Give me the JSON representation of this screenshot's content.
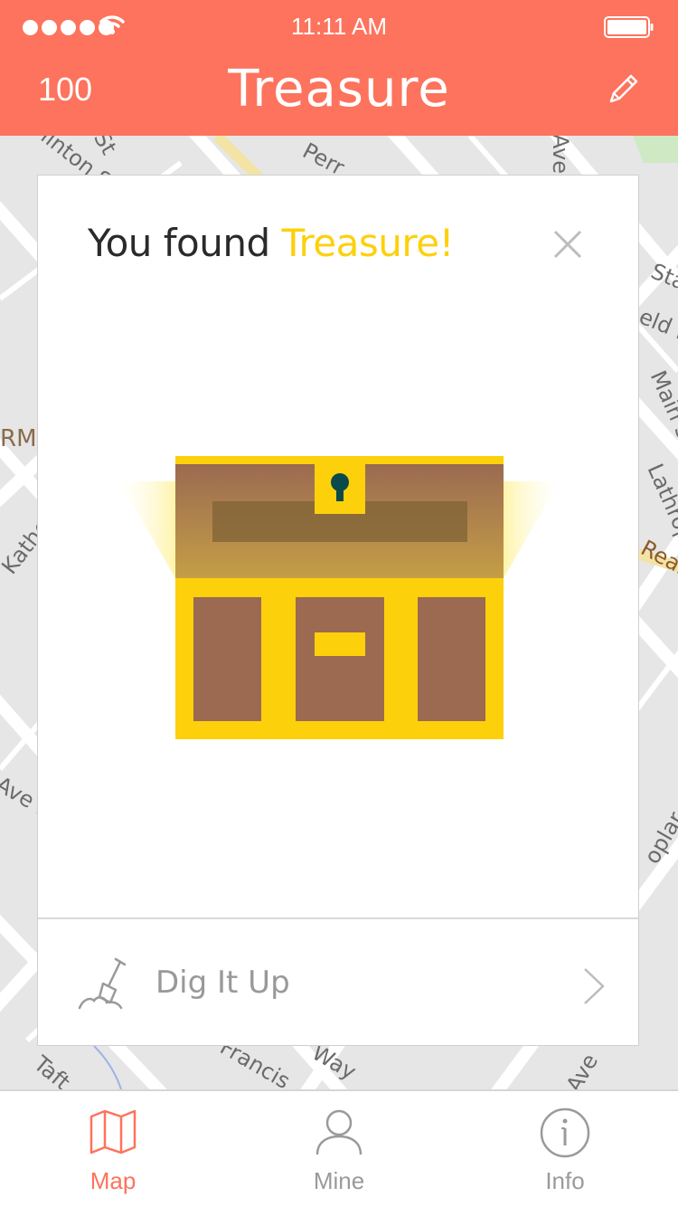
{
  "status_bar": {
    "time": "11:11 AM"
  },
  "header": {
    "score": "100",
    "title": "Treasure"
  },
  "map": {
    "labels": [
      "linton St",
      "St",
      "Perr",
      "Ave",
      "Sta",
      "eld R",
      "Main St",
      "RM",
      "Lathrop",
      "Real",
      "Kathe",
      "Ave De",
      "oplar",
      "Taft",
      "Francis",
      "Way",
      "Ave"
    ]
  },
  "card": {
    "heading_prefix": "You found ",
    "heading_accent": "Treasure!",
    "action_label": "Dig It Up"
  },
  "tabs": [
    {
      "label": "Map",
      "active": true
    },
    {
      "label": "Mine",
      "active": false
    },
    {
      "label": "Info",
      "active": false
    }
  ],
  "colors": {
    "brand": "#fd735d",
    "accent_gold": "#fdd00c",
    "chest_brown": "#9b6a51",
    "keyhole": "#0b4a4a"
  }
}
